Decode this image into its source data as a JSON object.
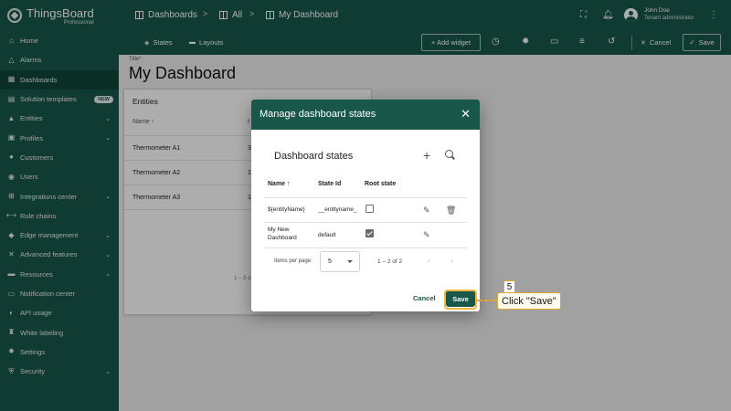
{
  "app": {
    "name": "ThingsBoard",
    "edition": "Professional"
  },
  "breadcrumb": [
    {
      "label": "Dashboards"
    },
    {
      "label": "All"
    },
    {
      "label": "My Dashboard"
    }
  ],
  "user": {
    "name": "John Doe",
    "role": "Tenant administrator"
  },
  "sidebar": {
    "items": [
      {
        "label": "Home",
        "icon": "home-icon",
        "glyph": "⌂",
        "has_children": false
      },
      {
        "label": "Alarms",
        "icon": "alarm-icon",
        "glyph": "△",
        "has_children": false
      },
      {
        "label": "Dashboards",
        "icon": "dashboards-icon",
        "glyph": "▦",
        "has_children": false,
        "active": true
      },
      {
        "label": "Solution templates",
        "icon": "solution-templates-icon",
        "glyph": "▤",
        "has_children": false,
        "badge": "NEW"
      },
      {
        "label": "Entities",
        "icon": "entities-icon",
        "glyph": "▲",
        "has_children": true
      },
      {
        "label": "Profiles",
        "icon": "profiles-icon",
        "glyph": "▣",
        "has_children": true
      },
      {
        "label": "Customers",
        "icon": "customers-icon",
        "glyph": "●",
        "has_children": false
      },
      {
        "label": "Users",
        "icon": "users-icon",
        "glyph": "◉",
        "has_children": false
      },
      {
        "label": "Integrations center",
        "icon": "integrations-icon",
        "glyph": "⊞",
        "has_children": true
      },
      {
        "label": "Rule chains",
        "icon": "rule-chains-icon",
        "glyph": "⟷",
        "has_children": false
      },
      {
        "label": "Edge management",
        "icon": "edge-icon",
        "glyph": "◆",
        "has_children": true
      },
      {
        "label": "Advanced features",
        "icon": "advanced-features-icon",
        "glyph": "✕",
        "has_children": true
      },
      {
        "label": "Resources",
        "icon": "resources-icon",
        "glyph": "▬",
        "has_children": true
      },
      {
        "label": "Notification center",
        "icon": "notification-center-icon",
        "glyph": "▭",
        "has_children": false
      },
      {
        "label": "API usage",
        "icon": "api-usage-icon",
        "glyph": "◐",
        "has_children": false
      },
      {
        "label": "White labeling",
        "icon": "white-labeling-icon",
        "glyph": "♜",
        "has_children": false
      },
      {
        "label": "Settings",
        "icon": "settings-icon",
        "glyph": "✹",
        "has_children": false
      },
      {
        "label": "Security",
        "icon": "security-icon",
        "glyph": "⛨",
        "has_children": true
      }
    ]
  },
  "toolbar": {
    "tabs": [
      {
        "label": "States",
        "icon": "states-icon"
      },
      {
        "label": "Layouts",
        "icon": "layouts-icon"
      }
    ],
    "add_widget_label": "+ Add widget",
    "cancel_label": "Cancel",
    "save_label": "Save"
  },
  "dashboard": {
    "title_caption": "Title*",
    "title": "My Dashboard",
    "widget": {
      "title": "Entities",
      "columns": [
        "Name",
        "t"
      ],
      "rows": [
        {
          "name": "Thermometer A1",
          "col2": "3"
        },
        {
          "name": "Thermometer A2",
          "col2": "1"
        },
        {
          "name": "Thermometer A3",
          "col2": "1"
        }
      ],
      "pagination": "1 – 3 o"
    }
  },
  "dialog": {
    "title": "Manage dashboard states",
    "section_title": "Dashboard states",
    "columns": {
      "name": "Name",
      "state_id": "State Id",
      "root_state": "Root state"
    },
    "rows": [
      {
        "name": "${entityName}",
        "state_id": "__entityname_",
        "root_state": false,
        "deletable": true
      },
      {
        "name": "My New Dashboard",
        "state_id": "default",
        "root_state": true,
        "deletable": false
      }
    ],
    "items_per_page_label": "Items per page:",
    "items_per_page": "5",
    "range_label": "1 – 2 of 2",
    "cancel_label": "Cancel",
    "save_label": "Save"
  },
  "annotation": {
    "step": "5",
    "text": "Click \"Save\""
  },
  "colors": {
    "primary": "#18574a",
    "highlight": "#f3b63f"
  }
}
